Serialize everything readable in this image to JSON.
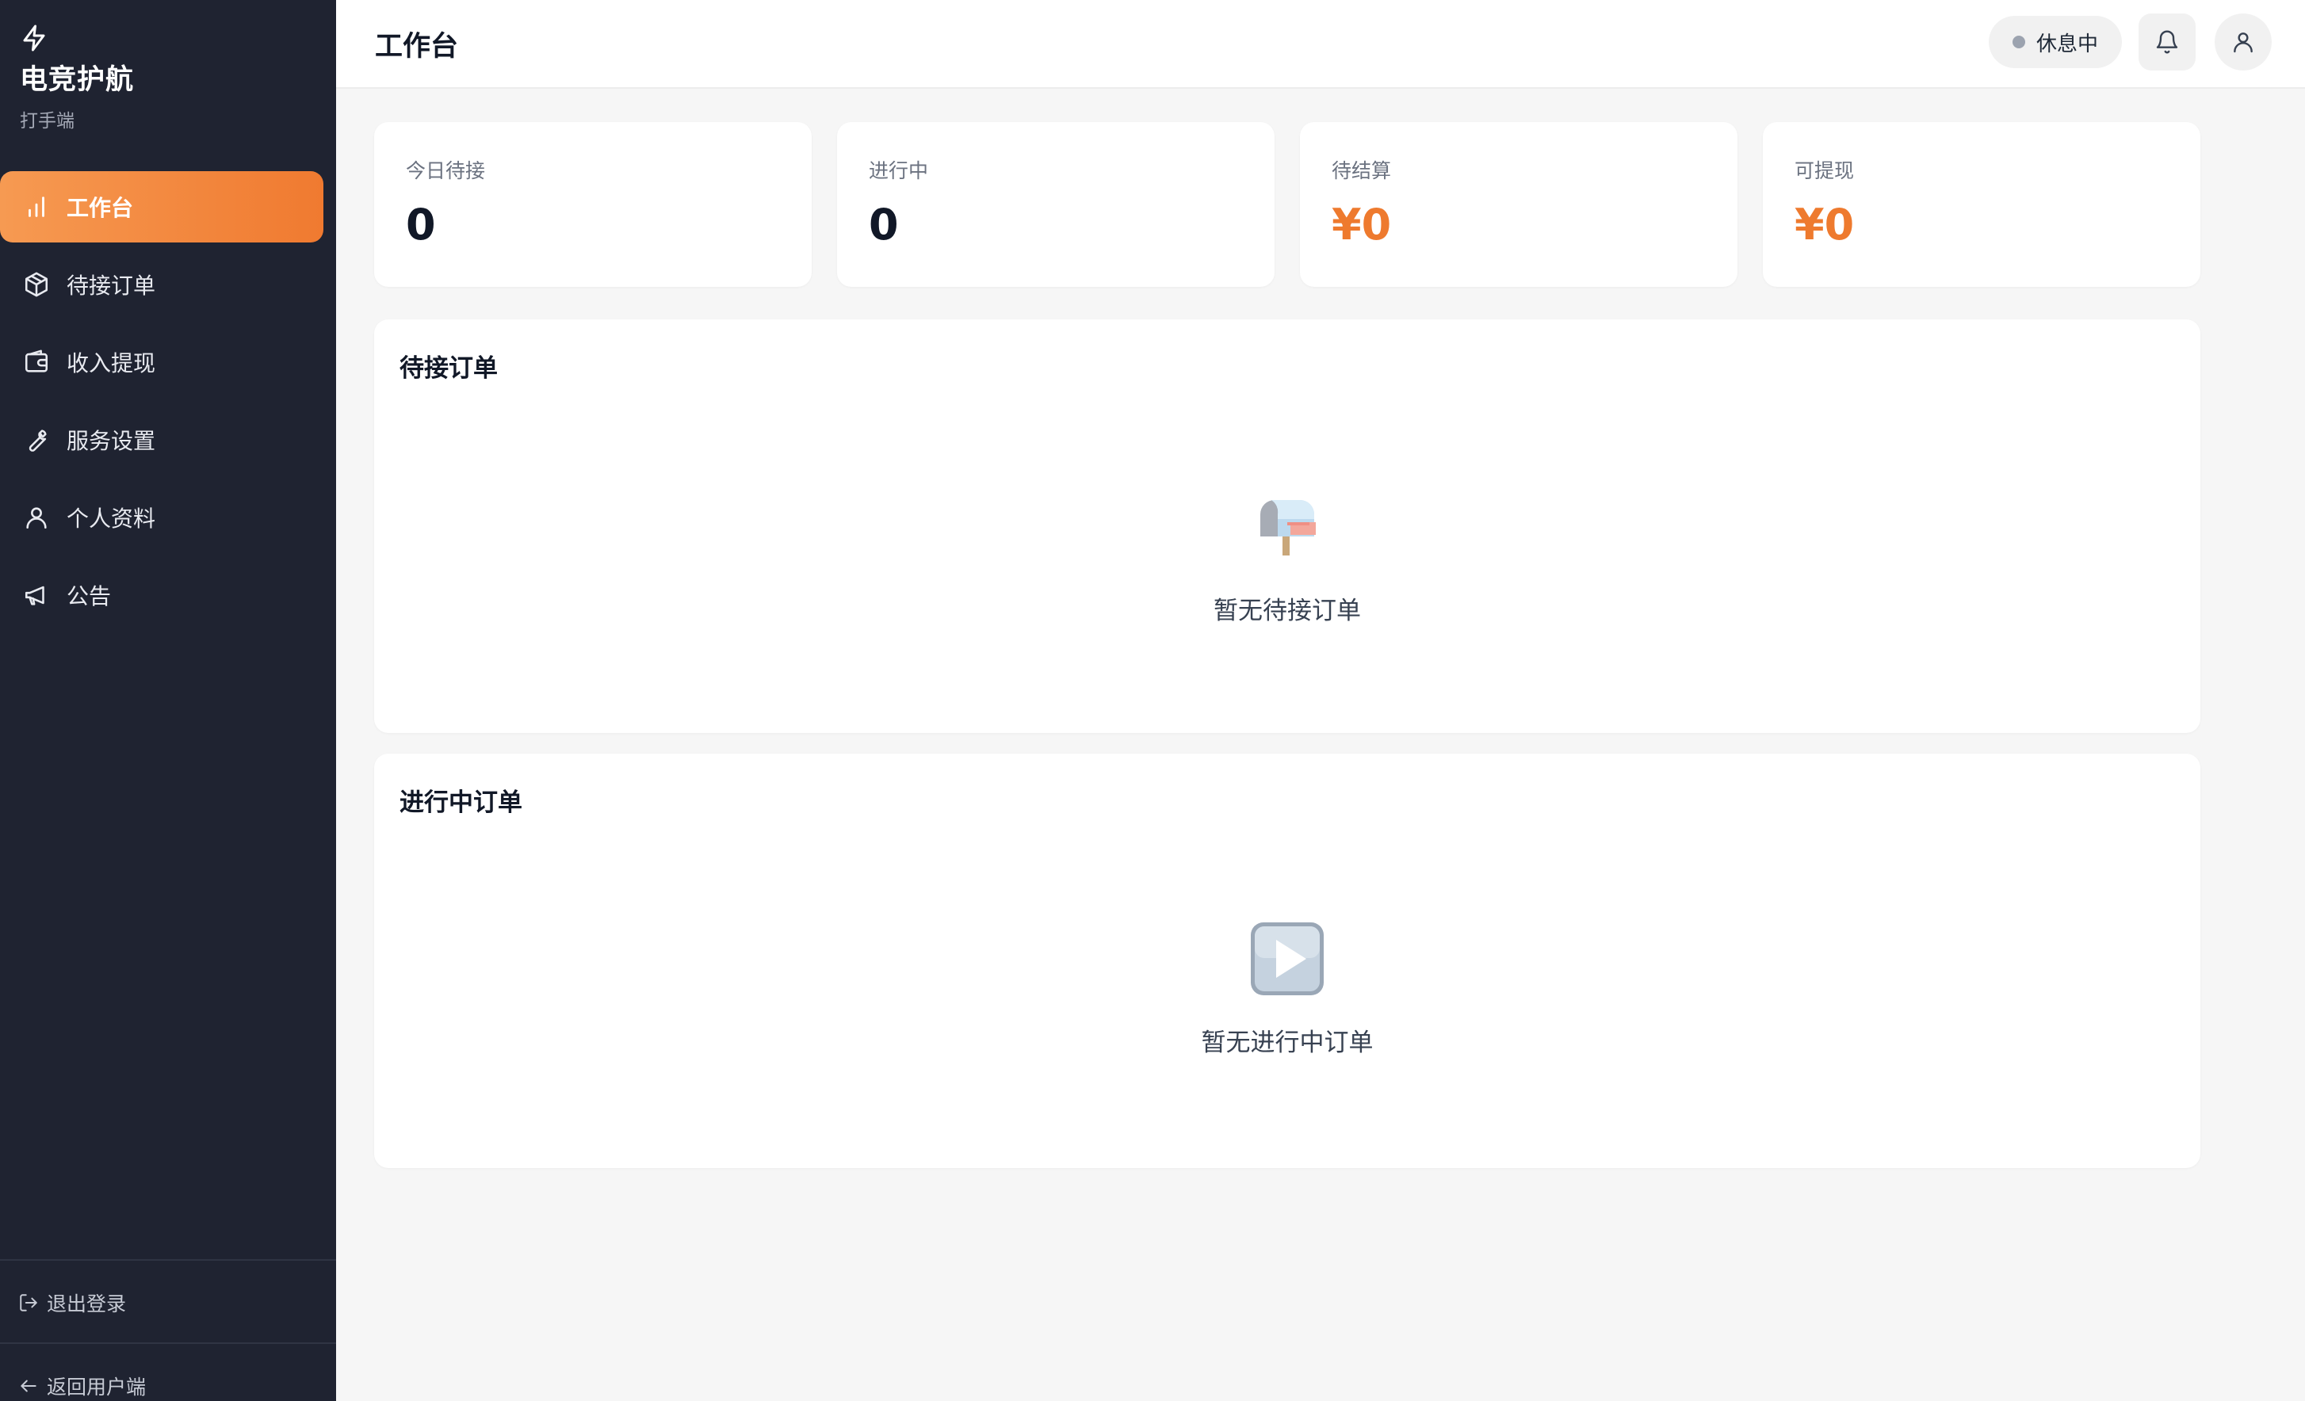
{
  "brand": {
    "title": "电竞护航",
    "subtitle": "打手端",
    "icon": "lightning-icon"
  },
  "sidebar": {
    "items": [
      {
        "label": "工作台",
        "icon": "bar-chart-icon",
        "active": true
      },
      {
        "label": "待接订单",
        "icon": "package-icon",
        "active": false
      },
      {
        "label": "收入提现",
        "icon": "wallet-icon",
        "active": false
      },
      {
        "label": "服务设置",
        "icon": "wrench-icon",
        "active": false
      },
      {
        "label": "个人资料",
        "icon": "user-icon",
        "active": false
      },
      {
        "label": "公告",
        "icon": "megaphone-icon",
        "active": false
      }
    ],
    "logout_label": "退出登录",
    "back_label": "返回用户端"
  },
  "header": {
    "title": "工作台",
    "status_label": "休息中",
    "status_color": "#9ca3af"
  },
  "stats": [
    {
      "label": "今日待接",
      "value": "0"
    },
    {
      "label": "进行中",
      "value": "0"
    },
    {
      "label": "待结算",
      "value": "¥0"
    },
    {
      "label": "可提现",
      "value": "¥0"
    }
  ],
  "panels": {
    "pending": {
      "title": "待接订单",
      "empty_text": "暂无待接订单",
      "icon": "mailbox-icon"
    },
    "in_progress": {
      "title": "进行中订单",
      "empty_text": "暂无进行中订单",
      "icon": "play-button-icon"
    }
  },
  "colors": {
    "accent": "#f07a30",
    "sidebar_bg": "#1f2331",
    "money": "#ee7a2e"
  }
}
